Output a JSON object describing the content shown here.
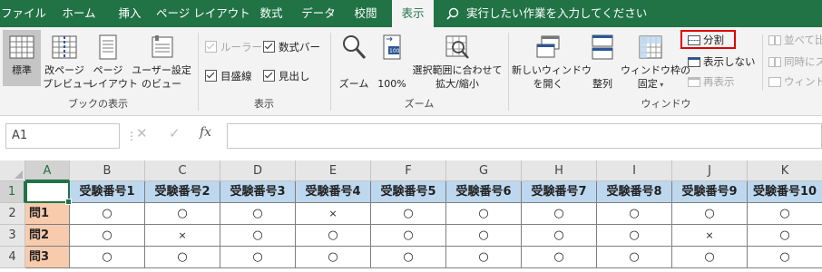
{
  "tabs": [
    "ファイル",
    "ホーム",
    "挿入",
    "ページ レイアウト",
    "数式",
    "データ",
    "校閲",
    "表示"
  ],
  "active_tab": "表示",
  "search_text": "実行したい作業を入力してください",
  "ribbon": {
    "workbook_views": {
      "normal": "標準",
      "page_break_1": "改ページ",
      "page_break_2": "プレビュー",
      "page_layout_1": "ページ",
      "page_layout_2": "レイアウト",
      "custom_1": "ユーザー設定",
      "custom_2": "のビュー",
      "group_label": "ブックの表示"
    },
    "show": {
      "ruler": "ルーラー",
      "formula_bar": "数式バー",
      "gridlines": "目盛線",
      "headings": "見出し",
      "group_label": "表示"
    },
    "zoom": {
      "zoom": "ズーム",
      "hundred": "100%",
      "zoom_sel_1": "選択範囲に合わせて",
      "zoom_sel_2": "拡大/縮小",
      "group_label": "ズーム"
    },
    "window": {
      "new_window_1": "新しいウィンドウ",
      "new_window_2": "を開く",
      "arrange": "整列",
      "freeze_1": "ウィンドウ枠の",
      "freeze_2": "固定",
      "split": "分割",
      "hide": "表示しない",
      "unhide": "再表示",
      "side_by_side": "並べて比",
      "sync_scroll": "同時にス",
      "reset_pos": "ウィンドウ",
      "group_label": "ウィンドウ"
    }
  },
  "formula_bar": {
    "name_box": "A1",
    "cancel": "✕",
    "enter": "✓",
    "fx": "fx"
  },
  "sheet": {
    "columns": [
      "A",
      "B",
      "C",
      "D",
      "E",
      "F",
      "G",
      "H",
      "I",
      "J",
      "K"
    ],
    "rows": [
      "1",
      "2",
      "3",
      "4"
    ],
    "header_row": [
      "",
      "受験番号1",
      "受験番号2",
      "受験番号3",
      "受験番号4",
      "受験番号5",
      "受験番号6",
      "受験番号7",
      "受験番号8",
      "受験番号9",
      "受験番号10"
    ],
    "data_rows": [
      {
        "label": "問1",
        "values": [
          "○",
          "○",
          "○",
          "×",
          "○",
          "○",
          "○",
          "○",
          "○",
          "○"
        ]
      },
      {
        "label": "問2",
        "values": [
          "○",
          "×",
          "○",
          "○",
          "○",
          "○",
          "○",
          "○",
          "×",
          "○"
        ]
      },
      {
        "label": "問3",
        "values": [
          "○",
          "○",
          "○",
          "○",
          "○",
          "○",
          "○",
          "○",
          "○",
          "○"
        ]
      }
    ]
  },
  "colors": {
    "accent": "#217346",
    "header_fill": "#bdd7ee",
    "question_fill": "#f8cbad",
    "highlight_box": "#e00000"
  }
}
